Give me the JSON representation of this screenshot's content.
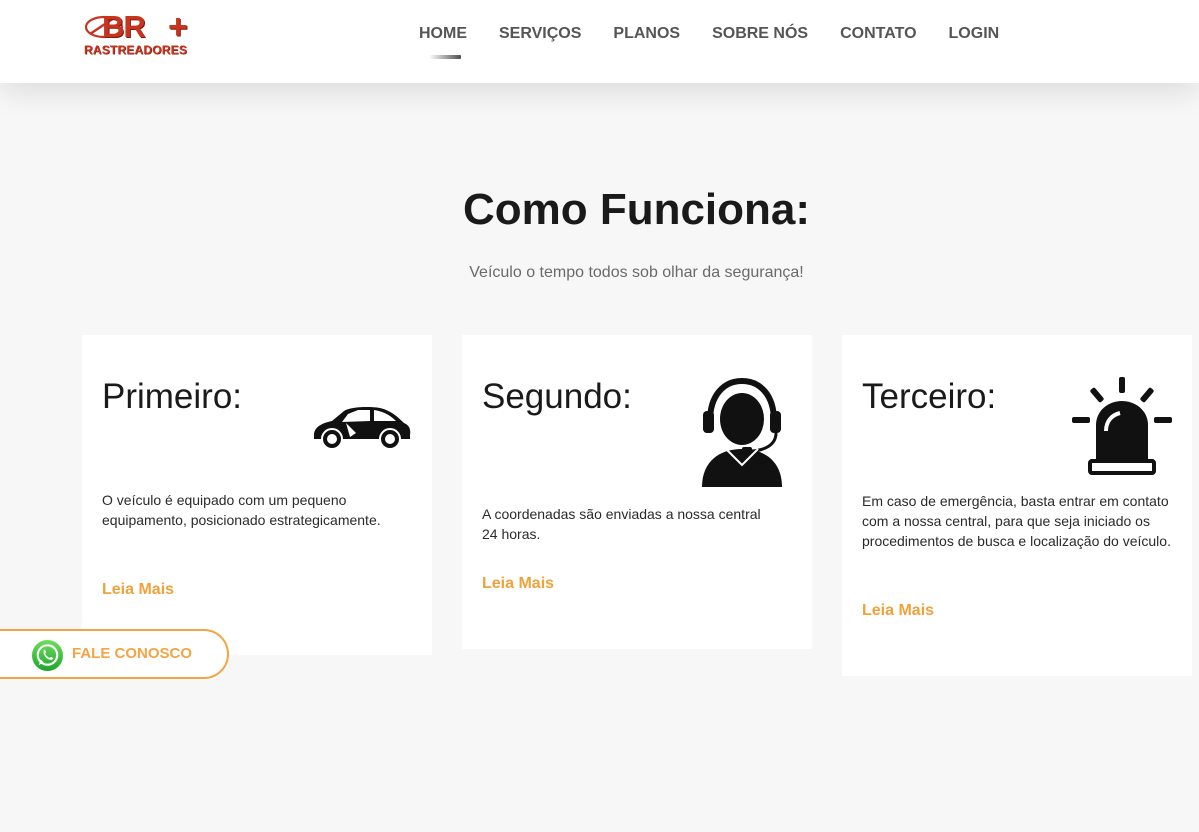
{
  "header": {
    "logo": {
      "line1": "BR",
      "plus": "+",
      "line2": "RASTREADORES"
    },
    "nav": [
      {
        "label": "HOME",
        "active": true
      },
      {
        "label": "SERVIÇOS"
      },
      {
        "label": "PLANOS"
      },
      {
        "label": "SOBRE NÓS"
      },
      {
        "label": "CONTATO"
      },
      {
        "label": "LOGIN"
      }
    ]
  },
  "section": {
    "title": "Como Funciona:",
    "subtitle": "Veículo o tempo todos sob olhar da segurança!"
  },
  "cards": [
    {
      "title": "Primeiro:",
      "icon": "car-icon",
      "text": "O veículo é equipado com um pequeno equipamento, posicionado estrategicamente.",
      "link": "Leia Mais"
    },
    {
      "title": "Segundo:",
      "icon": "headset-operator-icon",
      "text": "A coordenadas são enviadas a nossa central 24 horas.",
      "link": "Leia Mais"
    },
    {
      "title": "Terceiro:",
      "icon": "siren-icon",
      "text": "Em caso de emergência, basta entrar em contato com a nossa central, para que seja iniciado os procedimentos de busca e localização do veículo.",
      "link": "Leia Mais"
    }
  ],
  "whatsapp": {
    "label": "FALE CONOSCO",
    "icon": "whatsapp-icon"
  },
  "colors": {
    "accent": "#f2a545",
    "brand": "#c8341f",
    "background": "#f7f7f7"
  }
}
